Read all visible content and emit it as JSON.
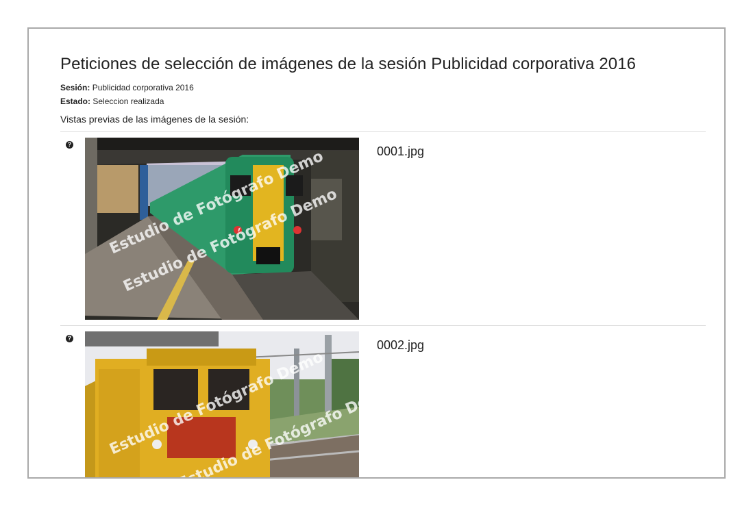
{
  "page": {
    "title": "Peticiones de selección de imágenes de la sesión Publicidad corporativa 2016",
    "session_label": "Sesión:",
    "session_value": "Publicidad corporativa 2016",
    "status_label": "Estado:",
    "status_value": "Seleccion realizada",
    "intro": "Vistas previas de las imágenes de la sesión:"
  },
  "photos": [
    {
      "filename": "0001.jpg",
      "status_icon": "question-circle-icon",
      "status_glyph": "?",
      "watermark": "Estudio de Fotógrafo Demo"
    },
    {
      "filename": "0002.jpg",
      "status_icon": "question-circle-icon",
      "status_glyph": "?",
      "watermark": "Estudio de Fotógrafo Demo"
    }
  ],
  "colors": {
    "frame_border": "#a9a9a9",
    "divider": "#dddddd",
    "text": "#222222"
  }
}
